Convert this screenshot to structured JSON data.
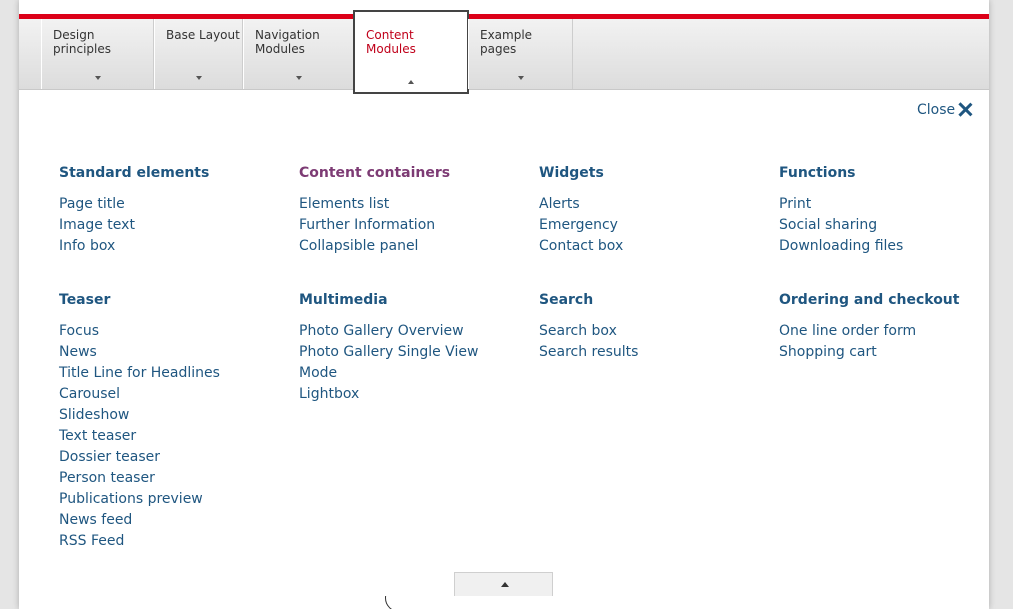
{
  "nav": {
    "items": [
      {
        "label": "Design principles"
      },
      {
        "label": "Base Layout"
      },
      {
        "label": "Navigation Modules"
      },
      {
        "label": "Content Modules",
        "active": true
      },
      {
        "label": "Example pages"
      }
    ]
  },
  "close_label": "Close",
  "groups": [
    {
      "title": "Standard elements",
      "items": [
        "Page title",
        "Image text",
        "Info box"
      ]
    },
    {
      "title": "Content containers",
      "items": [
        "Elements list",
        "Further Information",
        "Collapsible panel"
      ]
    },
    {
      "title": "Widgets",
      "items": [
        "Alerts",
        "Emergency",
        "Contact box"
      ]
    },
    {
      "title": "Functions",
      "items": [
        "Print",
        "Social sharing",
        "Downloading files"
      ]
    },
    {
      "title": "Teaser",
      "items": [
        "Focus",
        "News",
        "Title Line for Headlines",
        "Carousel",
        "Slideshow",
        "Text teaser",
        "Dossier teaser",
        "Person teaser",
        "Publications preview",
        "News feed",
        "RSS Feed"
      ]
    },
    {
      "title": "Multimedia",
      "items": [
        "Photo Gallery Overview",
        "Photo Gallery Single View",
        "Mode",
        "Lightbox"
      ]
    },
    {
      "title": "Search",
      "items": [
        "Search box",
        "Search results"
      ]
    },
    {
      "title": "Ordering and checkout",
      "items": [
        "One line order form",
        "Shopping cart"
      ]
    }
  ],
  "colors": {
    "brand_red": "#dc0018",
    "link_blue": "#1f5680",
    "heading_purple": "#7d3b74",
    "active_tab_text": "#c0001a"
  }
}
